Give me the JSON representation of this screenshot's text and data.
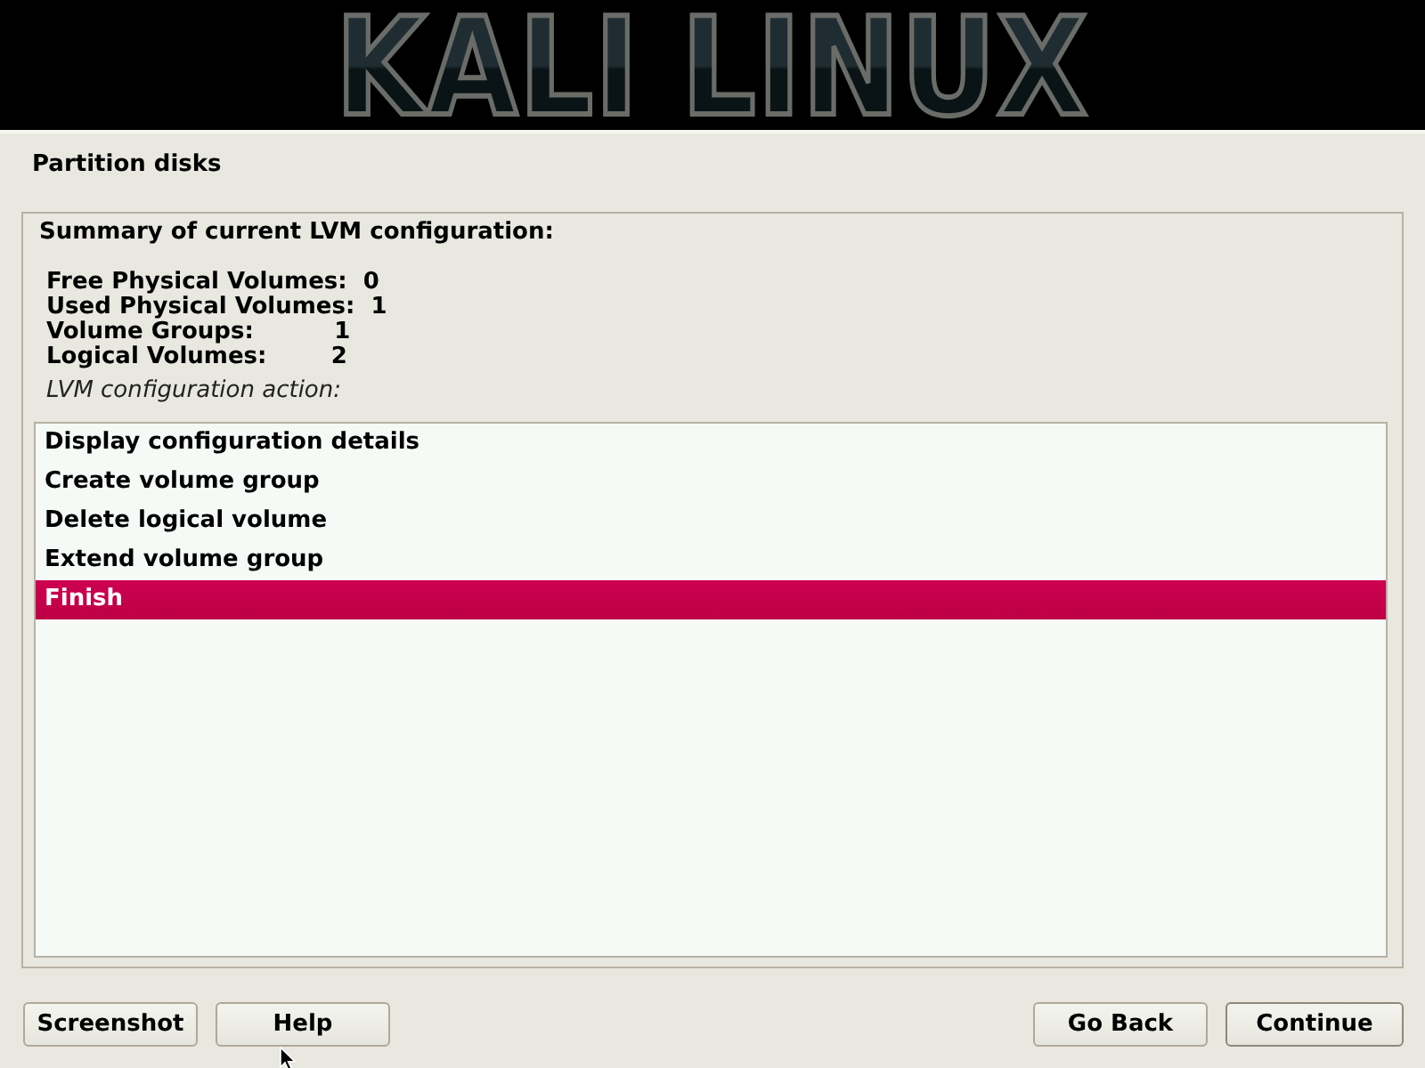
{
  "banner": {
    "logo": "KALI LINUX"
  },
  "page_title": "Partition disks",
  "panel": {
    "heading": "Summary of current LVM configuration:",
    "summary_lines": [
      "Free Physical Volumes:  0",
      "Used Physical Volumes:  1",
      "Volume Groups:          1",
      "Logical Volumes:        2"
    ],
    "prompt": "LVM configuration action:"
  },
  "actions": [
    {
      "label": "Display configuration details",
      "selected": false
    },
    {
      "label": "Create volume group",
      "selected": false
    },
    {
      "label": "Delete logical volume",
      "selected": false
    },
    {
      "label": "Extend volume group",
      "selected": false
    },
    {
      "label": "Finish",
      "selected": true
    }
  ],
  "buttons_left": [
    "Screenshot",
    "Help"
  ],
  "buttons_right": [
    "Go Back",
    "Continue"
  ]
}
